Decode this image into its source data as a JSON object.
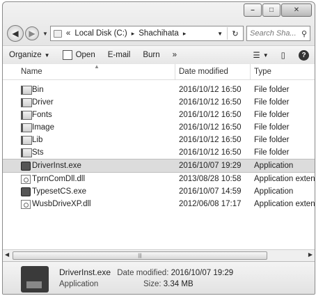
{
  "window": {
    "caption_buttons": {
      "minimize": "–",
      "maximize": "□",
      "close": "✕"
    }
  },
  "address_bar": {
    "overflow": "«",
    "segments": [
      "Local Disk (C:)",
      "Shachihata"
    ],
    "separator": "▸",
    "search_placeholder": "Search Sha...",
    "refresh_glyph": "↻"
  },
  "toolbar": {
    "organize": "Organize",
    "open": "Open",
    "email": "E-mail",
    "burn": "Burn",
    "more": "»",
    "help": "?"
  },
  "columns": {
    "name": "Name",
    "date_modified": "Date modified",
    "type": "Type"
  },
  "files": [
    {
      "name": "Bin",
      "date": "2016/10/12 16:50",
      "type": "File folder",
      "icon": "folder-icon"
    },
    {
      "name": "Driver",
      "date": "2016/10/12 16:50",
      "type": "File folder",
      "icon": "folder-icon"
    },
    {
      "name": "Fonts",
      "date": "2016/10/12 16:50",
      "type": "File folder",
      "icon": "folder-icon"
    },
    {
      "name": "Image",
      "date": "2016/10/12 16:50",
      "type": "File folder",
      "icon": "folder-icon"
    },
    {
      "name": "Lib",
      "date": "2016/10/12 16:50",
      "type": "File folder",
      "icon": "folder-icon"
    },
    {
      "name": "Sts",
      "date": "2016/10/12 16:50",
      "type": "File folder",
      "icon": "folder-icon"
    },
    {
      "name": "DriverInst.exe",
      "date": "2016/10/07 19:29",
      "type": "Application",
      "icon": "application-icon",
      "selected": true
    },
    {
      "name": "TprnComDll.dll",
      "date": "2013/08/28 10:58",
      "type": "Application extens...",
      "icon": "dll-icon"
    },
    {
      "name": "TypesetCS.exe",
      "date": "2016/10/07 14:59",
      "type": "Application",
      "icon": "application-icon"
    },
    {
      "name": "WusbDriveXP.dll",
      "date": "2012/06/08 17:17",
      "type": "Application extens...",
      "icon": "dll-icon"
    }
  ],
  "details_pane": {
    "filename": "DriverInst.exe",
    "date_label": "Date modified:",
    "date_value": "2016/10/07 19:29",
    "type": "Application",
    "size_label": "Size:",
    "size_value": "3.34 MB"
  }
}
